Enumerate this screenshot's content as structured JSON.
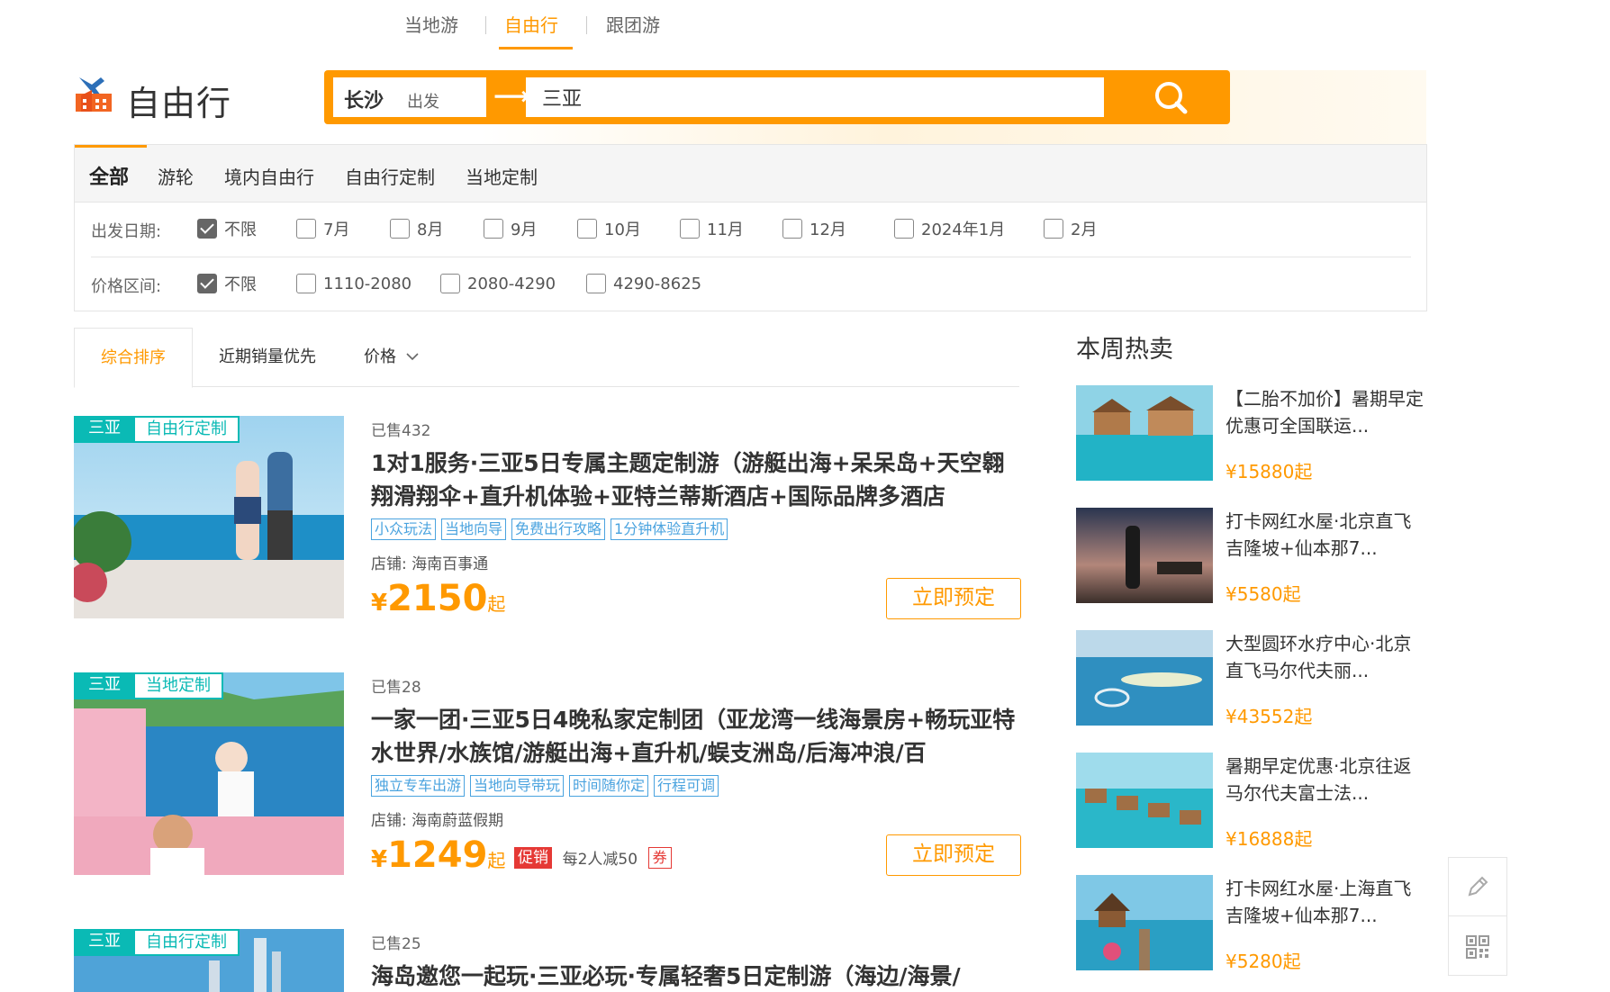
{
  "top_tabs": [
    {
      "label": "当地游"
    },
    {
      "label": "自由行"
    },
    {
      "label": "跟团游"
    }
  ],
  "brand": {
    "title": "自由行",
    "logo_icon": "plane-building-logo"
  },
  "search": {
    "from_city": "长沙",
    "from_suffix": "出发",
    "arrow": "→",
    "to_value": "三亚",
    "button_icon": "search-icon"
  },
  "categories": [
    "全部",
    "游轮",
    "境内自由行",
    "自由行定制",
    "当地定制"
  ],
  "filters": {
    "date": {
      "label": "出发日期:",
      "options": [
        "不限",
        "7月",
        "8月",
        "9月",
        "10月",
        "11月",
        "12月",
        "2024年1月",
        "2月"
      ],
      "checked": "不限"
    },
    "price": {
      "label": "价格区间:",
      "options": [
        "不限",
        "1110-2080",
        "2080-4290",
        "4290-8625"
      ],
      "checked": "不限"
    }
  },
  "sort": {
    "comprehensive": "综合排序",
    "sales": "近期销量优先",
    "price": "价格"
  },
  "products": [
    {
      "dest_tag": "三亚",
      "type_tag": "自由行定制",
      "sold": "已售432",
      "title": "1对1服务·三亚5日专属主题定制游（游艇出海+呆呆岛+天空翱翔滑翔伞+直升机体验+亚特兰蒂斯酒店+国际品牌多酒店",
      "tags": [
        "小众玩法",
        "当地向导",
        "免费出行攻略",
        "1分钟体验直升机"
      ],
      "shop": "店铺: 海南百事通",
      "currency": "¥",
      "price": "2150",
      "price_suffix": "起",
      "book": "立即预定"
    },
    {
      "dest_tag": "三亚",
      "type_tag": "当地定制",
      "sold": "已售28",
      "title": "一家一团·三亚5日4晚私家定制团（亚龙湾一线海景房+畅玩亚特水世界/水族馆/游艇出海+直升机/蜈支洲岛/后海冲浪/百",
      "tags": [
        "独立专车出游",
        "当地向导带玩",
        "时间随你定",
        "行程可调"
      ],
      "shop": "店铺: 海南蔚蓝假期",
      "currency": "¥",
      "price": "1249",
      "price_suffix": "起",
      "promo": "促销",
      "promo_text": "每2人减50",
      "coupon": "券",
      "book": "立即预定"
    },
    {
      "dest_tag": "三亚",
      "type_tag": "自由行定制",
      "sold": "已售25",
      "title": "海岛邀您一起玩·三亚必玩·专属轻奢5日定制游（海边/海景/"
    }
  ],
  "hot": {
    "title": "本周热卖",
    "items": [
      {
        "title": "【二胎不加价】暑期早定优惠可全国联运...",
        "price": "¥15880起"
      },
      {
        "title": "打卡网红水屋·北京直飞吉隆坡+仙本那7...",
        "price": "¥5580起"
      },
      {
        "title": "大型圆环水疗中心·北京直飞马尔代夫丽...",
        "price": "¥43552起"
      },
      {
        "title": "暑期早定优惠·北京往返马尔代夫富士法...",
        "price": "¥16888起"
      },
      {
        "title": "打卡网红水屋·上海直飞吉隆坡+仙本那7...",
        "price": "¥5280起"
      }
    ]
  },
  "tools": [
    "edit-icon",
    "qrcode-icon"
  ],
  "colors": {
    "accent": "#ff9900",
    "teal": "#0abab5",
    "tag_blue": "#4aa3df",
    "promo_red": "#e53935"
  }
}
